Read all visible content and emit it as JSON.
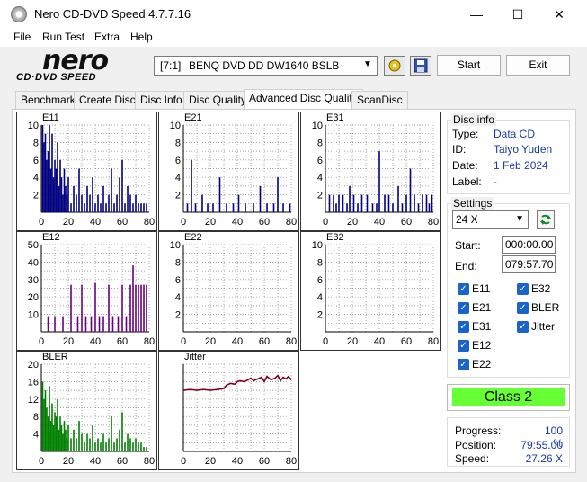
{
  "window": {
    "title": "Nero CD-DVD Speed 4.7.7.16",
    "minimize": "—",
    "maximize": "☐",
    "close": "✕"
  },
  "menu": [
    "File",
    "Run Test",
    "Extra",
    "Help"
  ],
  "logo": {
    "brand": "nero",
    "subtitle": "CD·DVD SPEED"
  },
  "toolbar": {
    "drive_id": "[7:1]",
    "drive_name": "BENQ DVD DD DW1640 BSLB",
    "start_label": "Start",
    "exit_label": "Exit"
  },
  "tabs": [
    "Benchmark",
    "Create Disc",
    "Disc Info",
    "Disc Quality",
    "Advanced Disc Quality",
    "ScanDisc"
  ],
  "active_tab": "Advanced Disc Quality",
  "disc_info": {
    "label": "Disc info",
    "type_label": "Type:",
    "type": "Data CD",
    "id_label": "ID:",
    "id": "Taiyo Yuden",
    "date_label": "Date:",
    "date": "1 Feb 2024",
    "disc_label_label": "Label:",
    "disc_label": "-"
  },
  "settings": {
    "label": "Settings",
    "speed": "24 X",
    "start_label": "Start:",
    "start": "000:00.00",
    "end_label": "End:",
    "end": "079:57.70",
    "checks": [
      "E11",
      "E32",
      "E21",
      "BLER",
      "E31",
      "Jitter",
      "E12",
      "E22"
    ]
  },
  "class_label": "Class 2",
  "progress": {
    "progress_label": "Progress:",
    "progress": "100 %",
    "position_label": "Position:",
    "position": "79:55.00",
    "speed_label": "Speed:",
    "speed": "27.26 X"
  },
  "colors": {
    "navy": "#000080",
    "purple": "#6a0080",
    "green": "#008000",
    "maroon": "#800020",
    "class_bg": "#66ff33"
  },
  "chart_data": [
    {
      "name": "E11",
      "type": "bar",
      "x_ticks": [
        0,
        20,
        40,
        60,
        80
      ],
      "y_ticks": [
        0,
        2,
        4,
        6,
        8,
        10
      ],
      "ylim": [
        0,
        10
      ],
      "x": [
        1,
        2,
        3,
        4,
        5,
        6,
        7,
        8,
        9,
        10,
        11,
        12,
        13,
        14,
        15,
        16,
        17,
        18,
        19,
        20,
        22,
        24,
        26,
        28,
        30,
        32,
        34,
        36,
        38,
        40,
        42,
        44,
        46,
        48,
        50,
        52,
        54,
        56,
        58,
        60,
        62,
        64,
        66,
        68,
        70,
        72,
        74,
        76,
        78
      ],
      "values": [
        10,
        8,
        9,
        6,
        7,
        10,
        5,
        9,
        4,
        6,
        5,
        8,
        3,
        6,
        4,
        2,
        5,
        3,
        2,
        4,
        1,
        3,
        2,
        5,
        2,
        1,
        3,
        2,
        4,
        1,
        2,
        1,
        3,
        1,
        2,
        5,
        1,
        2,
        4,
        6,
        1,
        3,
        2,
        1,
        2,
        1,
        1,
        1,
        1
      ]
    },
    {
      "name": "E21",
      "type": "bar",
      "x_ticks": [
        0,
        20,
        40,
        60,
        80
      ],
      "y_ticks": [
        0,
        2,
        4,
        6,
        8,
        10
      ],
      "ylim": [
        0,
        10
      ],
      "x": [
        3,
        6,
        9,
        14,
        18,
        22,
        27,
        32,
        37,
        41,
        46,
        52,
        57,
        62,
        67,
        70,
        74,
        79
      ],
      "values": [
        1,
        6,
        1,
        2,
        1,
        1,
        4,
        1,
        1,
        2,
        1,
        1,
        3,
        1,
        1,
        4,
        1,
        1
      ]
    },
    {
      "name": "E31",
      "type": "bar",
      "x_ticks": [
        0,
        20,
        40,
        60,
        80
      ],
      "y_ticks": [
        0,
        2,
        4,
        6,
        8,
        10
      ],
      "ylim": [
        0,
        10
      ],
      "x": [
        3,
        6,
        8,
        10,
        13,
        16,
        18,
        21,
        24,
        27,
        31,
        35,
        38,
        40,
        44,
        47,
        50,
        54,
        57,
        60,
        63,
        66,
        69,
        72,
        75,
        77,
        79
      ],
      "values": [
        2,
        2,
        1,
        2,
        2,
        1,
        3,
        2,
        1,
        2,
        2,
        1,
        1,
        7,
        2,
        2,
        1,
        3,
        1,
        2,
        5,
        2,
        1,
        2,
        2,
        1,
        2
      ]
    },
    {
      "name": "E12",
      "type": "bar",
      "x_ticks": [
        0,
        20,
        40,
        60,
        80
      ],
      "y_ticks": [
        0,
        10,
        20,
        30,
        40,
        50
      ],
      "ylim": [
        0,
        50
      ],
      "x": [
        5,
        10,
        16,
        22,
        27,
        30,
        33,
        37,
        40,
        43,
        46,
        50,
        53,
        57,
        60,
        63,
        66,
        68,
        70,
        72,
        74,
        76,
        78
      ],
      "values": [
        9,
        9,
        9,
        27,
        9,
        27,
        9,
        9,
        28,
        9,
        9,
        27,
        9,
        9,
        27,
        9,
        27,
        38,
        27,
        27,
        27,
        27,
        27
      ]
    },
    {
      "name": "E22",
      "type": "bar",
      "x_ticks": [
        0,
        20,
        40,
        60,
        80
      ],
      "y_ticks": [
        0,
        2,
        4,
        6,
        8,
        10
      ],
      "ylim": [
        0,
        10
      ],
      "x": [],
      "values": []
    },
    {
      "name": "E32",
      "type": "bar",
      "x_ticks": [
        0,
        20,
        40,
        60,
        80
      ],
      "y_ticks": [
        0,
        2,
        4,
        6,
        8,
        10
      ],
      "ylim": [
        0,
        10
      ],
      "x": [],
      "values": []
    },
    {
      "name": "BLER",
      "type": "bar",
      "x_ticks": [
        0,
        20,
        40,
        60,
        80
      ],
      "y_ticks": [
        0,
        4,
        8,
        12,
        16,
        20
      ],
      "ylim": [
        0,
        20
      ],
      "x": [
        1,
        2,
        3,
        4,
        5,
        6,
        7,
        8,
        9,
        10,
        11,
        12,
        13,
        14,
        15,
        16,
        17,
        18,
        19,
        20,
        22,
        24,
        26,
        28,
        30,
        32,
        34,
        36,
        38,
        40,
        42,
        44,
        46,
        48,
        50,
        52,
        54,
        56,
        58,
        60,
        62,
        64,
        66,
        68,
        70,
        72,
        74,
        76,
        78
      ],
      "values": [
        16,
        12,
        14,
        10,
        8,
        15,
        7,
        11,
        6,
        9,
        8,
        12,
        5,
        8,
        6,
        4,
        7,
        5,
        3,
        6,
        3,
        5,
        3,
        7,
        4,
        2,
        4,
        3,
        6,
        2,
        3,
        2,
        4,
        2,
        3,
        8,
        2,
        3,
        5,
        9,
        2,
        4,
        3,
        2,
        3,
        2,
        2,
        1,
        1
      ]
    },
    {
      "name": "Jitter",
      "type": "line",
      "x_ticks": [
        0,
        20,
        40,
        60,
        80
      ],
      "y_ticks": [],
      "ylim": [
        0,
        10
      ],
      "x": [
        0,
        5,
        10,
        15,
        20,
        25,
        30,
        32,
        35,
        38,
        40,
        42,
        45,
        48,
        50,
        52,
        55,
        58,
        60,
        62,
        65,
        68,
        70,
        72,
        74,
        76,
        78,
        80
      ],
      "values": [
        7.0,
        7.1,
        7.0,
        7.1,
        7.0,
        7.1,
        7.2,
        7.6,
        7.8,
        7.7,
        8.0,
        8.1,
        8.0,
        8.2,
        8.4,
        8.1,
        8.3,
        8.5,
        8.0,
        8.6,
        8.2,
        8.4,
        8.7,
        8.1,
        8.5,
        8.3,
        8.6,
        8.2
      ]
    }
  ]
}
